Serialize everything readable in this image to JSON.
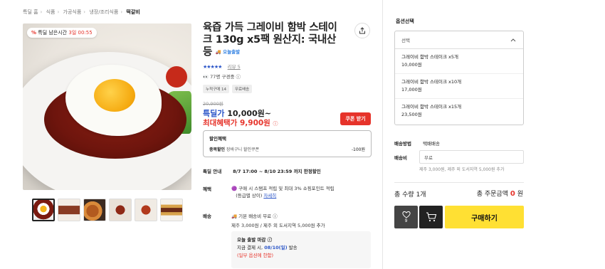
{
  "breadcrumb": [
    "특딜 홈",
    "식품",
    "가공식품",
    "냉장/조리식품",
    "떡갈비"
  ],
  "product": {
    "timer": {
      "pct_icon": "%",
      "label": "특딜 남은시간",
      "days": "3일",
      "time": "00:55"
    },
    "title": "육즙 가득 그레이비 함박 스테이크 130g x5팩 원산지: 국내산 등",
    "today_badge": "오늘출발",
    "rating": {
      "stars": "★★★★★",
      "review_label": "리뷰 5"
    },
    "buyers": "77명 구경중",
    "tags": [
      "누적구매 14",
      "무료배송"
    ],
    "original_price": "20,900원",
    "deal_label": "특딜가",
    "deal_price": "10,000원~",
    "max_benefit_label": "최대혜택가",
    "max_benefit_price": "9,900원",
    "coupon_button": "쿠폰 받기",
    "discount": {
      "header": "할인혜택",
      "row_label": "중복할인",
      "row_sub": "장바구니 할인쿠폰",
      "row_amount": "-100원"
    },
    "guide": {
      "label": "특딜 안내",
      "value": "8/7 17:00 ~ 8/10 23:59 까지 한정할인"
    },
    "benefit": {
      "label": "혜택",
      "line1": "구매 시 스탬프 적립 및 최대 3% 쇼핑포인트 적립",
      "line2": "(등급별 상이)",
      "link": "자세히"
    },
    "shipping": {
      "label": "배송",
      "line1": "기본 배송비 무료",
      "line2": "제주 3,000원 / 제주 외 도서지역 5,000원 추가"
    },
    "dispatch": {
      "title": "오늘 출발 마감",
      "line_prefix": "지금 결제 시,",
      "date": "08/10(일)",
      "line_suffix": "발송",
      "note": "(일부 옵션에 한함)"
    }
  },
  "options": {
    "title": "옵션선택",
    "placeholder": "선택",
    "items": [
      {
        "name": "그레이비 함박 스테이크 x5개",
        "price": "10,000원"
      },
      {
        "name": "그레이비 함박 스테이크 x10개",
        "price": "17,000원"
      },
      {
        "name": "그레이비 함박 스테이크 x15개",
        "price": "23,500원"
      }
    ]
  },
  "delivery": {
    "method_label": "배송방법",
    "method_value": "택배배송",
    "fee_label": "배송비",
    "fee_value": "무료",
    "fee_note": "제주 3,000원, 제주 외 도서지역 5,000원 추가"
  },
  "summary": {
    "qty_label": "총 수량",
    "qty_value": "1개",
    "total_label": "총 주문금액",
    "total_value": "0",
    "total_unit": "원"
  },
  "actions": {
    "wish_count": "9",
    "buy_label": "구매하기"
  },
  "colors": {
    "accent_red": "#e6332a",
    "accent_blue": "#2a55c8",
    "buy_yellow": "#ffe033"
  }
}
